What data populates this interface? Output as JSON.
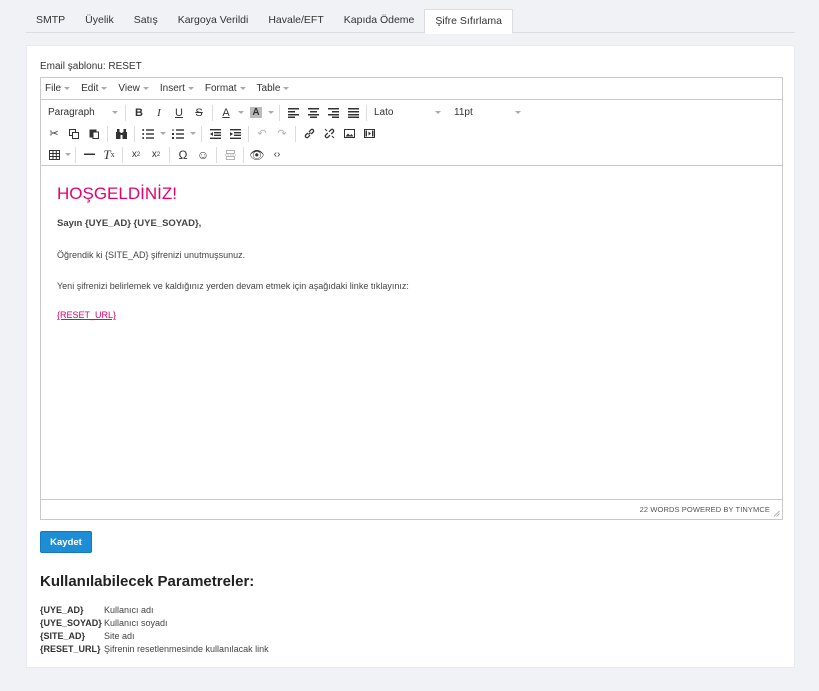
{
  "tabs": [
    {
      "label": "SMTP",
      "active": false
    },
    {
      "label": "Üyelik",
      "active": false
    },
    {
      "label": "Satış",
      "active": false
    },
    {
      "label": "Kargoya Verildi",
      "active": false
    },
    {
      "label": "Havale/EFT",
      "active": false
    },
    {
      "label": "Kapıda Ödeme",
      "active": false
    },
    {
      "label": "Şifre Sıfırlama",
      "active": true
    }
  ],
  "template_label": "Email şablonu: RESET",
  "editor": {
    "menu": [
      "File",
      "Edit",
      "View",
      "Insert",
      "Format",
      "Table"
    ],
    "toolbar": {
      "block_format": "Paragraph",
      "font_family": "Lato",
      "font_size": "11pt"
    },
    "content": {
      "title": "HOŞGELDİNİZ!",
      "greeting": "Sayın {UYE_AD} {UYE_SOYAD},",
      "paragraph1": "Öğrendik ki {SITE_AD} şifrenizi unutmuşsunuz.",
      "paragraph2": "Yeni şifrenizi belirlemek ve kaldığınız yerden devam etmek için aşağıdaki linke tıklayınız:",
      "link": "{RESET_URL}"
    },
    "status": "22 WORDS POWERED BY TINYMCE"
  },
  "save_label": "Kaydet",
  "params_title": "Kullanılabilecek Parametreler:",
  "params": [
    {
      "key": "{UYE_AD}",
      "desc": "Kullanıcı adı"
    },
    {
      "key": "{UYE_SOYAD}",
      "desc": "Kullanıcı soyadı"
    },
    {
      "key": "{SITE_AD}",
      "desc": "Site adı"
    },
    {
      "key": "{RESET_URL}",
      "desc": "Şifrenin resetlenmesinde kullanılacak link"
    }
  ],
  "colors": {
    "accent": "#e5006e",
    "button": "#1d8ed6",
    "background": "#f1f2f6"
  }
}
